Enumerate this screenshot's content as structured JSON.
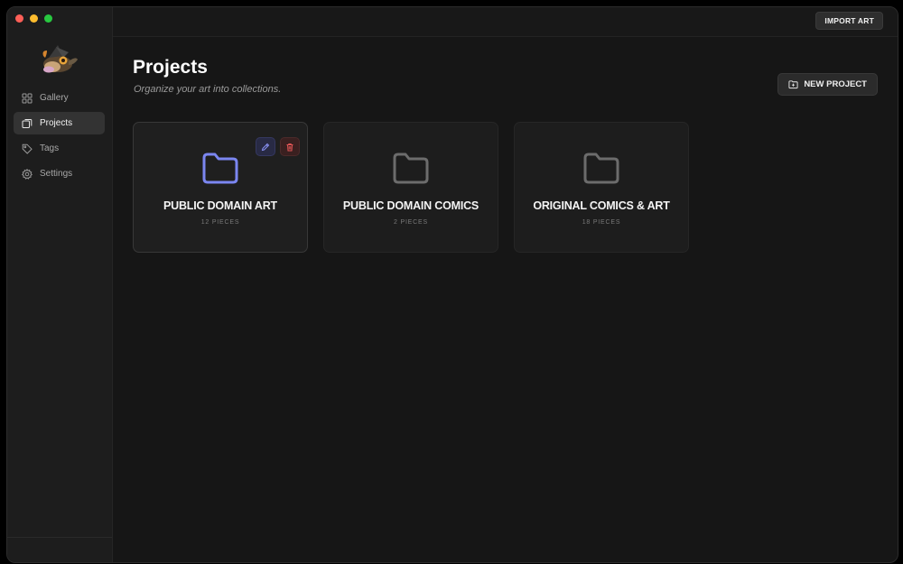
{
  "window": {
    "controls": [
      "close",
      "minimize",
      "zoom"
    ]
  },
  "sidebar": {
    "logo_icon": "app-logo-creature",
    "items": [
      {
        "label": "Gallery",
        "icon": "grid-icon",
        "active": false
      },
      {
        "label": "Projects",
        "icon": "layers-icon",
        "active": true
      },
      {
        "label": "Tags",
        "icon": "tag-icon",
        "active": false
      },
      {
        "label": "Settings",
        "icon": "gear-icon",
        "active": false
      }
    ]
  },
  "topbar": {
    "import_label": "IMPORT ART"
  },
  "main": {
    "title": "Projects",
    "subtitle": "Organize your art into collections.",
    "new_project_label": "NEW PROJECT",
    "projects": [
      {
        "name": "PUBLIC DOMAIN ART",
        "count": "12 PIECES",
        "highlighted": true
      },
      {
        "name": "PUBLIC DOMAIN COMICS",
        "count": "2 PIECES",
        "highlighted": false
      },
      {
        "name": "ORIGINAL COMICS & ART",
        "count": "18 PIECES",
        "highlighted": false
      }
    ]
  },
  "colors": {
    "accent": "#7b86f0",
    "folder_muted": "#6c6c6c",
    "delete": "#e05555",
    "edit": "#8a92f5"
  }
}
